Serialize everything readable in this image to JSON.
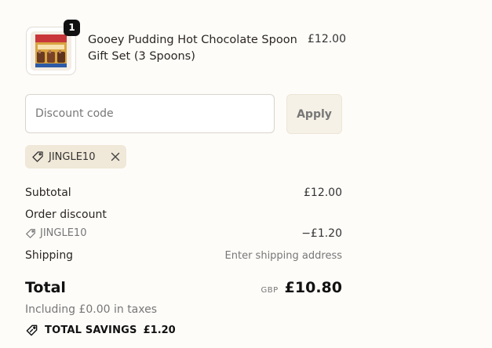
{
  "cart": {
    "item": {
      "name": "Gooey Pudding Hot Chocolate Spoon Gift Set (3 Spoons)",
      "price": "£12.00",
      "quantity": "1"
    }
  },
  "discount": {
    "placeholder": "Discount code",
    "apply_label": "Apply",
    "applied_code": "JINGLE10"
  },
  "summary": {
    "subtotal_label": "Subtotal",
    "subtotal_value": "£12.00",
    "order_discount_label": "Order discount",
    "discount_code": "JINGLE10",
    "discount_value": "−£1.20",
    "shipping_label": "Shipping",
    "shipping_value": "Enter shipping address",
    "total_label": "Total",
    "currency": "GBP",
    "total_value": "£10.80",
    "taxes_note": "Including £0.00 in taxes",
    "savings_label": "TOTAL SAVINGS",
    "savings_value": "£1.20"
  },
  "colors": {
    "background": "#fefcf9",
    "chip": "#f0e8d8",
    "apply_button": "#f5f1e6"
  }
}
